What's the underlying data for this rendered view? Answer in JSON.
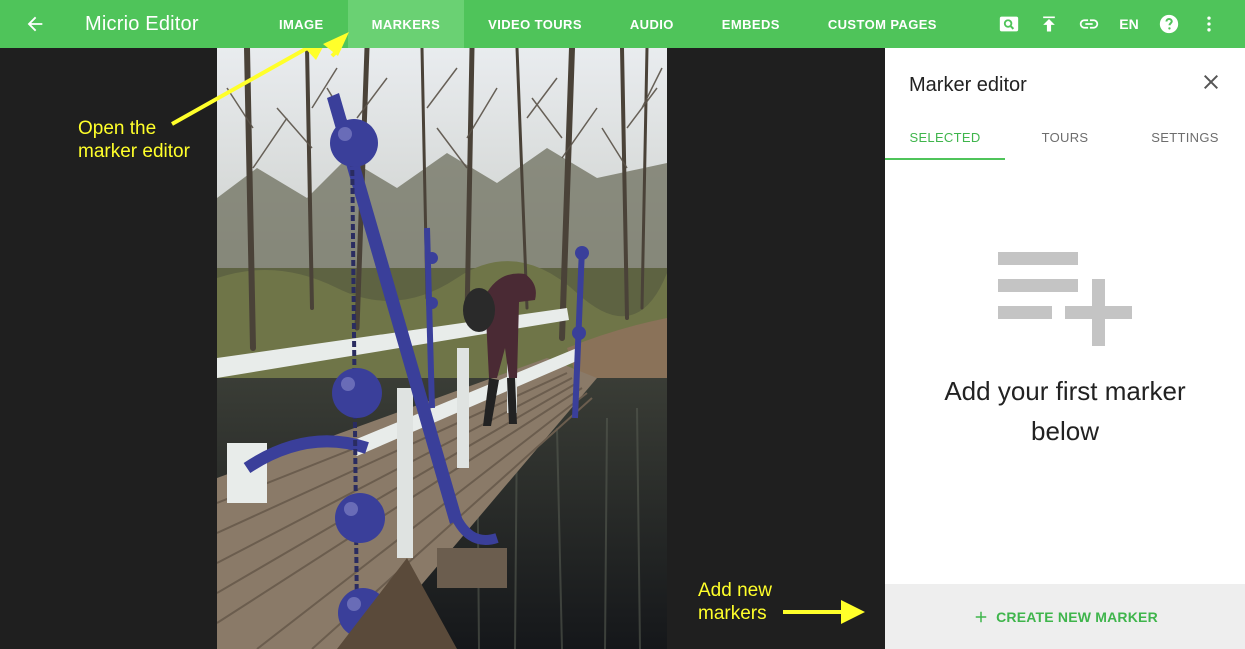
{
  "app": {
    "title": "Micrio Editor"
  },
  "tabs": [
    {
      "label": "IMAGE"
    },
    {
      "label": "MARKERS"
    },
    {
      "label": "VIDEO TOURS"
    },
    {
      "label": "AUDIO"
    },
    {
      "label": "EMBEDS"
    },
    {
      "label": "CUSTOM PAGES"
    }
  ],
  "active_tab": "MARKERS",
  "toolbar": {
    "icons": [
      "search-icon",
      "upload-icon",
      "link-icon",
      "help-icon",
      "more-vert-icon"
    ],
    "language": "EN"
  },
  "annotations": {
    "open_editor_line1": "Open the",
    "open_editor_line2": "marker editor",
    "add_markers_line1": "Add new",
    "add_markers_line2": "markers"
  },
  "panel": {
    "title": "Marker editor",
    "tabs": [
      {
        "label": "SELECTED"
      },
      {
        "label": "TOURS"
      },
      {
        "label": "SETTINGS"
      }
    ],
    "empty_message": "Add your first marker below",
    "create_button": "CREATE NEW MARKER"
  },
  "colors": {
    "brand": "#4fc45a",
    "annotation": "#ffff2a",
    "viewer_bg": "#1f1f1f"
  }
}
